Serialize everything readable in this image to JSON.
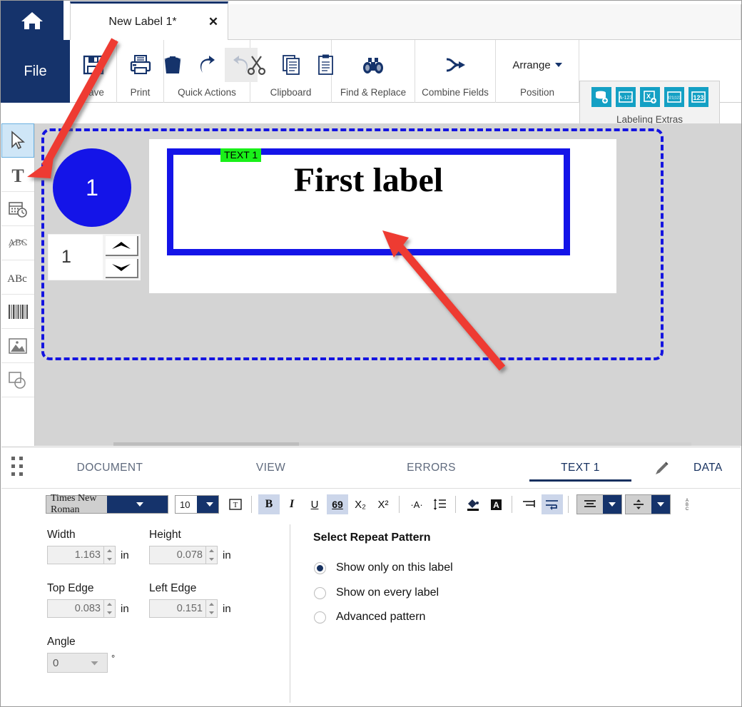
{
  "window": {
    "title": "New Label 1*"
  },
  "tabstrip": {
    "home_icon": "home-icon",
    "doc_tab_label": "New Label 1*",
    "close_label": "✕"
  },
  "ribbon": {
    "file_label": "File",
    "groups": [
      {
        "label": "Save",
        "icons": [
          "save-icon"
        ]
      },
      {
        "label": "Print",
        "icons": [
          "print-icon"
        ]
      },
      {
        "label": "Quick Actions",
        "icons": [
          "delete-icon",
          "undo-icon",
          "redo-icon"
        ]
      },
      {
        "label": "Clipboard",
        "icons": [
          "cut-icon",
          "copy-icon",
          "paste-icon"
        ]
      },
      {
        "label": "Find & Replace",
        "icons": [
          "binoculars-icon"
        ]
      },
      {
        "label": "Combine Fields",
        "icons": [
          "combine-icon"
        ]
      },
      {
        "label": "Position",
        "icons": []
      }
    ],
    "arrange_label": "Arrange",
    "extras_label": "Labeling Extras",
    "extras_icons": [
      "database-icon",
      "a123-icon",
      "x-object-icon",
      "serial-icon",
      "counter-icon"
    ],
    "extras_icon_labels": [
      "",
      "A-123",
      "",
      "321|123",
      "123"
    ],
    "accent_navy": "#15336b",
    "accent_teal": "#14a0c4"
  },
  "left_toolbar": {
    "tools": [
      {
        "name": "select-tool",
        "selected": true
      },
      {
        "name": "text-tool",
        "selected": false
      },
      {
        "name": "datetime-tool",
        "selected": false
      },
      {
        "name": "curved-text-tool",
        "selected": false
      },
      {
        "name": "paragraph-tool",
        "selected": false
      },
      {
        "name": "barcode-tool",
        "selected": false
      },
      {
        "name": "image-tool",
        "selected": false
      },
      {
        "name": "shape-tool",
        "selected": false
      }
    ]
  },
  "canvas": {
    "label_number": "1",
    "copies_value": "1",
    "object_tag": "TEXT 1",
    "label_text": "First label",
    "selection_color": "#1414e8",
    "tag_color": "#19f019"
  },
  "panel": {
    "tabs": [
      {
        "label": "DOCUMENT",
        "active": false
      },
      {
        "label": "VIEW",
        "active": false
      },
      {
        "label": "ERRORS",
        "active": false
      },
      {
        "label": "TEXT 1",
        "active": true
      },
      {
        "label": "DATA",
        "active": false
      }
    ],
    "edit_icon": "pencil-icon"
  },
  "format_toolbar": {
    "font_family": "Times New Roman",
    "font_size": "10",
    "buttons": [
      {
        "name": "autofit-text-button",
        "glyph": "Ⓣ",
        "on": false
      },
      {
        "name": "bold-button",
        "glyph": "B",
        "on": true
      },
      {
        "name": "italic-button",
        "glyph": "I",
        "on": false
      },
      {
        "name": "underline-button",
        "glyph": "U",
        "on": false
      },
      {
        "name": "strikethrough-button",
        "glyph": "69",
        "on": true
      },
      {
        "name": "subscript-button",
        "glyph": "X₂",
        "on": false
      },
      {
        "name": "superscript-button",
        "glyph": "X²",
        "on": false
      },
      {
        "name": "character-spacing-button",
        "glyph": "·A·",
        "on": false
      },
      {
        "name": "line-spacing-button",
        "glyph": "≡",
        "on": false
      },
      {
        "name": "text-color-button",
        "glyph": "◢",
        "on": false
      },
      {
        "name": "highlight-color-button",
        "glyph": "A",
        "on": false
      },
      {
        "name": "text-indent-button",
        "glyph": "⇥",
        "on": false
      },
      {
        "name": "word-wrap-button",
        "glyph": "↵",
        "on": true
      },
      {
        "name": "horizontal-align-button",
        "glyph": "≡",
        "on": false
      },
      {
        "name": "vertical-align-button",
        "glyph": "÷",
        "on": false
      },
      {
        "name": "text-direction-button",
        "glyph": "ABC",
        "on": false
      }
    ]
  },
  "properties": {
    "width_label": "Width",
    "width_value": "1.163",
    "height_label": "Height",
    "height_value": "0.078",
    "top_edge_label": "Top Edge",
    "top_edge_value": "0.083",
    "left_edge_label": "Left Edge",
    "left_edge_value": "0.151",
    "angle_label": "Angle",
    "angle_value": "0",
    "unit": "in",
    "degree": "°"
  },
  "repeat_pattern": {
    "title": "Select Repeat Pattern",
    "options": [
      {
        "label": "Show only on this label",
        "selected": true
      },
      {
        "label": "Show on every label",
        "selected": false
      },
      {
        "label": "Advanced pattern",
        "selected": false
      }
    ]
  },
  "annotations": {
    "arrow_color": "#ee3b33",
    "arrow1_target": "text-tool",
    "arrow2_target": "label-textbox"
  }
}
